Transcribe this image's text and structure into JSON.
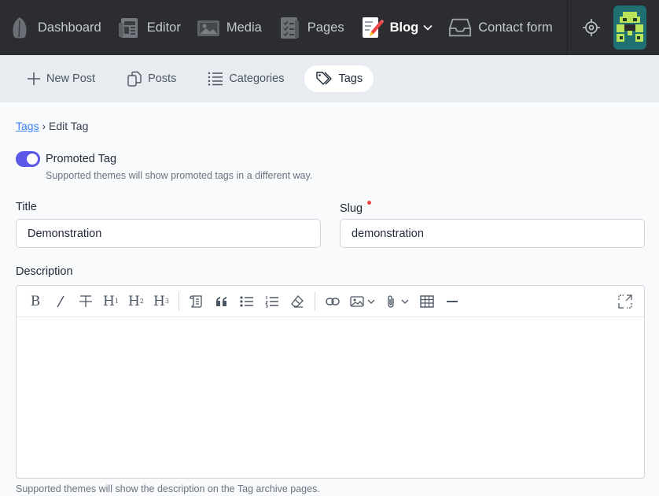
{
  "topnav": {
    "items": [
      {
        "label": "Dashboard",
        "icon": "leaf-icon"
      },
      {
        "label": "Editor",
        "icon": "newspaper-icon"
      },
      {
        "label": "Media",
        "icon": "image-icon"
      },
      {
        "label": "Pages",
        "icon": "pages-icon"
      },
      {
        "label": "Blog",
        "icon": "blog-pencil-icon",
        "active": true
      },
      {
        "label": "Contact form",
        "icon": "inbox-icon"
      }
    ]
  },
  "subnav": {
    "items": [
      {
        "label": "New Post",
        "icon": "plus-icon"
      },
      {
        "label": "Posts",
        "icon": "copy-icon"
      },
      {
        "label": "Categories",
        "icon": "list-icon"
      },
      {
        "label": "Tags",
        "icon": "tag-icon",
        "active": true
      }
    ]
  },
  "breadcrumb": {
    "parent": "Tags",
    "separator": "›",
    "current": "Edit Tag"
  },
  "promoted": {
    "label": "Promoted Tag",
    "enabled": true,
    "help": "Supported themes will show promoted tags in a different way."
  },
  "form": {
    "title_label": "Title",
    "title_value": "Demonstration",
    "slug_label": "Slug",
    "slug_value": "demonstration",
    "description_label": "Description",
    "description_help": "Supported themes will show the description on the Tag archive pages."
  },
  "editor_toolbar": {
    "bold": "B",
    "h1": "H",
    "h1_sub": "1",
    "h2": "H",
    "h2_sub": "2",
    "h3": "H",
    "h3_sub": "3"
  },
  "colors": {
    "accent": "#5b57e8",
    "topbar": "#2b2d30",
    "link": "#3b82f6",
    "required": "#ef4444"
  }
}
